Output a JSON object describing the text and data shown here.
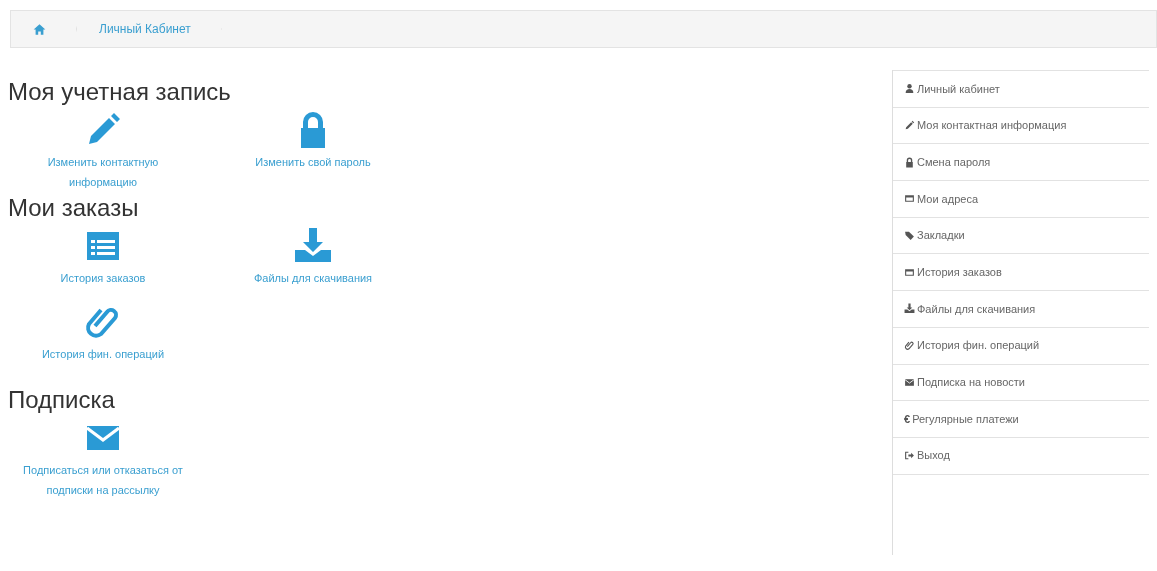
{
  "breadcrumb": [
    {
      "kind": "home"
    },
    {
      "kind": "text",
      "label": "Личный Кабинет"
    }
  ],
  "sections": [
    {
      "title": "Моя учетная запись",
      "links": [
        {
          "kind": "pencil",
          "label": "Изменить контактную информацию"
        },
        {
          "kind": "lock",
          "label": "Изменить свой пароль"
        }
      ]
    },
    {
      "title": "Мои заказы",
      "links": [
        {
          "kind": "list",
          "label": "История заказов"
        },
        {
          "kind": "download",
          "label": "Файлы для скачивания"
        },
        {
          "kind": "paperclip",
          "label": "История фин. операций"
        }
      ]
    },
    {
      "title": "Подписка",
      "links": [
        {
          "kind": "envelope",
          "label": "Подписаться или отказаться от подписки на рассылку"
        }
      ]
    }
  ],
  "sidebar": {
    "items": [
      {
        "kind": "user",
        "label": "Личный кабинет"
      },
      {
        "kind": "pencil",
        "label": "Моя контактная информация"
      },
      {
        "kind": "lock",
        "label": "Смена пароля"
      },
      {
        "kind": "card",
        "label": "Мои адреса"
      },
      {
        "kind": "tag",
        "label": "Закладки"
      },
      {
        "kind": "card",
        "label": "История заказов"
      },
      {
        "kind": "download",
        "label": "Файлы для скачивания"
      },
      {
        "kind": "paperclip",
        "label": "История фин. операций"
      },
      {
        "kind": "envelope",
        "label": "Подписка на новости"
      },
      {
        "kind": "char",
        "char": "€",
        "label": "Регулярные платежи"
      },
      {
        "kind": "signout",
        "label": "Выход"
      }
    ]
  }
}
